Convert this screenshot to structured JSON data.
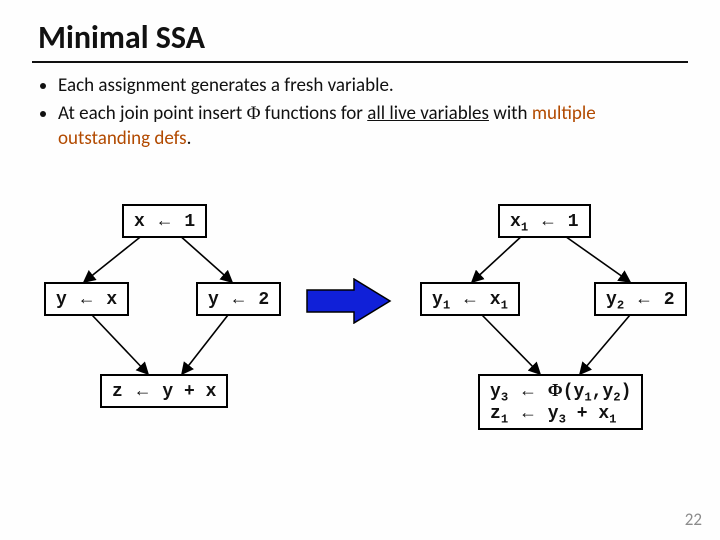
{
  "title": "Minimal SSA",
  "bullets": [
    "Each assignment generates a fresh variable.",
    "At each join point insert Φ functions for all live variables with multiple outstanding defs."
  ],
  "bullet2_prefix": "At each join point insert ",
  "bullet2_phi": "Φ",
  "bullet2_mid": " functions for ",
  "bullet2_underline": "all live variables",
  "bullet2_after": " with ",
  "bullet2_brown": "multiple outstanding defs",
  "bullet2_end": ".",
  "left": {
    "top": "x ← 1",
    "left": "y ← x",
    "right": "y ← 2",
    "bottom": "z ← y + x"
  },
  "right": {
    "top": "x₁ ← 1",
    "left": "y₁ ← x₁",
    "right": "y₂ ← 2",
    "bottom_line1": "y₃ ← Φ(y₁,y₂)",
    "bottom_line2": "z₁ ← y₃ + x₁"
  },
  "slide_number": "22"
}
